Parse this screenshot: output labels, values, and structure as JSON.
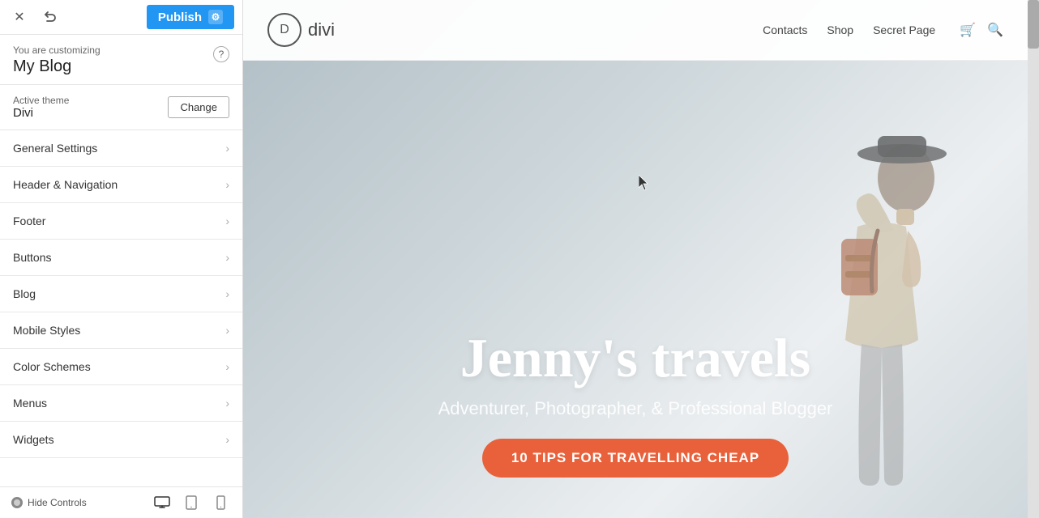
{
  "topBar": {
    "publishLabel": "Publish",
    "gearSymbol": "⚙"
  },
  "customizing": {
    "label": "You are customizing",
    "title": "My Blog",
    "helpSymbol": "?"
  },
  "theme": {
    "label": "Active theme",
    "name": "Divi",
    "changeLabel": "Change"
  },
  "menu": [
    {
      "id": "general-settings",
      "label": "General Settings"
    },
    {
      "id": "header-navigation",
      "label": "Header & Navigation"
    },
    {
      "id": "footer",
      "label": "Footer"
    },
    {
      "id": "buttons",
      "label": "Buttons"
    },
    {
      "id": "blog",
      "label": "Blog"
    },
    {
      "id": "mobile-styles",
      "label": "Mobile Styles"
    },
    {
      "id": "color-schemes",
      "label": "Color Schemes"
    },
    {
      "id": "menus",
      "label": "Menus"
    },
    {
      "id": "widgets",
      "label": "Widgets"
    }
  ],
  "bottomBar": {
    "hideControlsLabel": "Hide Controls"
  },
  "site": {
    "logoLetter": "D",
    "logoText": "divi",
    "nav": [
      {
        "id": "contacts",
        "label": "Contacts"
      },
      {
        "id": "shop",
        "label": "Shop"
      },
      {
        "id": "secret-page",
        "label": "Secret Page"
      }
    ]
  },
  "hero": {
    "title": "Jenny's travels",
    "subtitle": "Adventurer, Photographer, & Professional Blogger",
    "ctaLabel": "10 TIPS FOR TRAVELLING CHEAP"
  }
}
